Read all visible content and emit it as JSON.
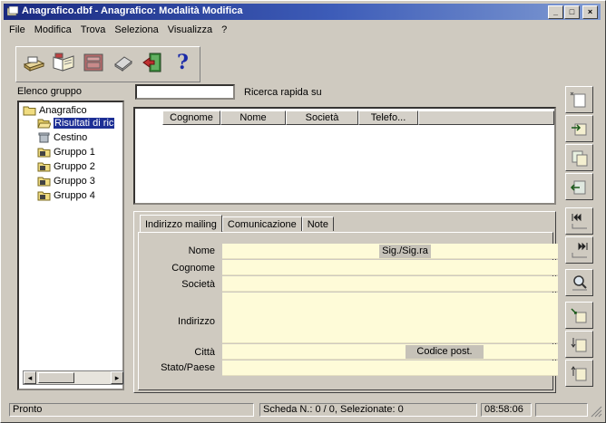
{
  "window": {
    "title": "Anagrafico.dbf - Anagrafico: Modalità Modifica",
    "controls": [
      "_",
      "□",
      "×"
    ]
  },
  "menu": [
    "File",
    "Modifica",
    "Trova",
    "Seleziona",
    "Visualizza",
    "?"
  ],
  "toolbar": {
    "icons": [
      "print-icon",
      "open-book-icon",
      "keyboard-icon",
      "eraser-icon",
      "exit-door-icon",
      "help-icon"
    ],
    "help_label": "?"
  },
  "left_panel": {
    "header": "Elenco gruppo",
    "tree": {
      "root": "Anagrafico",
      "items": [
        "Risultati di ric",
        "Cestino",
        "Gruppo 1",
        "Gruppo 2",
        "Gruppo 3",
        "Gruppo 4"
      ]
    },
    "scroll": {
      "left": "◂",
      "right": "▸"
    }
  },
  "search": {
    "value": "",
    "label": "Ricerca rapida su"
  },
  "list": {
    "columns": [
      "Cognome",
      "Nome",
      "Società",
      "Telefo..."
    ],
    "rows": []
  },
  "tabs": [
    "Indirizzo mailing",
    "Comunicazione",
    "Note"
  ],
  "form": {
    "labels": [
      "Nome",
      "Cognome",
      "Società",
      "Indirizzo",
      "Città",
      "Stato/Paese"
    ],
    "title_field": "Sig./Sig.ra",
    "postal_code_label": "Codice post."
  },
  "right_toolbar": {
    "icons": [
      "new-record-icon",
      "add-record-icon",
      "copy-record-icon",
      "delete-record-icon",
      "first-record-icon",
      "last-record-icon",
      "find-icon",
      "move-icon",
      "sort-az-icon",
      "sort-za-icon"
    ]
  },
  "status": {
    "state": "Pronto",
    "record": "Scheda N.: 0 / 0,  Selezionate: 0",
    "time": "08:58:06"
  }
}
